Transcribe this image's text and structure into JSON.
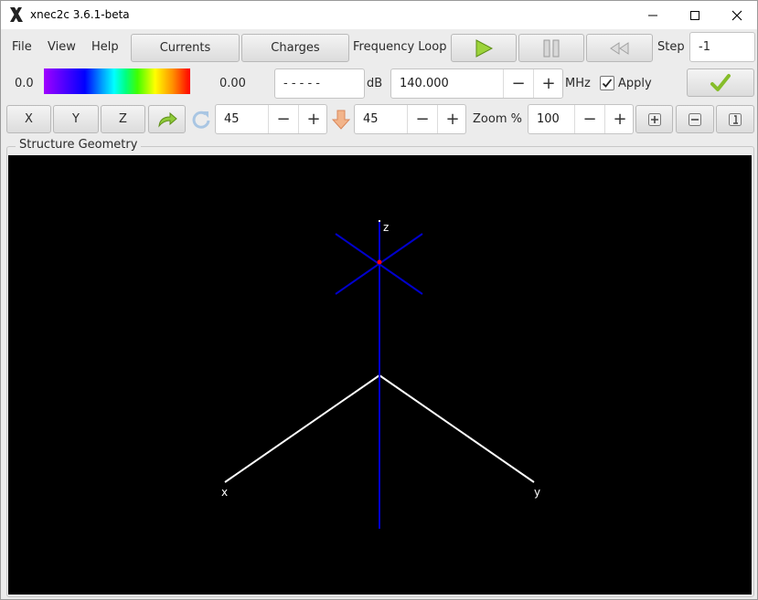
{
  "window": {
    "title": "xnec2c 3.6.1-beta"
  },
  "menu": {
    "file": "File",
    "view": "View",
    "help": "Help"
  },
  "toolbar": {
    "currents": "Currents",
    "charges": "Charges",
    "frequency_loop": "Frequency Loop",
    "step_label": "Step",
    "step_value": "-1"
  },
  "status": {
    "scale_min": "0.0",
    "scale_max": "0.00",
    "db_value": "- - - - -",
    "db_unit": "dB",
    "frequency": "140.000",
    "freq_unit": "MHz",
    "apply_label": "Apply",
    "apply_checked": true
  },
  "view_controls": {
    "x": "X",
    "y": "Y",
    "z": "Z",
    "rotate_value": "45",
    "tilt_value": "45",
    "zoom_label": "Zoom %",
    "zoom_value": "100"
  },
  "geometry": {
    "frame_title": "Structure Geometry",
    "axis_x": "x",
    "axis_y": "y",
    "axis_z": "z",
    "axis_color": "#ffffff",
    "wire_color": "#0000cc",
    "feed_color": "#ff0000"
  },
  "icons": {
    "play": "play-icon",
    "pause": "pause-icon",
    "rewind": "rewind-icon",
    "apply": "checkmark-icon",
    "rotate": "rotate-icon",
    "tilt": "tilt-icon",
    "zoom_in": "zoom-in-icon",
    "zoom_out": "zoom-out-icon",
    "zoom_reset": "zoom-reset-icon"
  }
}
